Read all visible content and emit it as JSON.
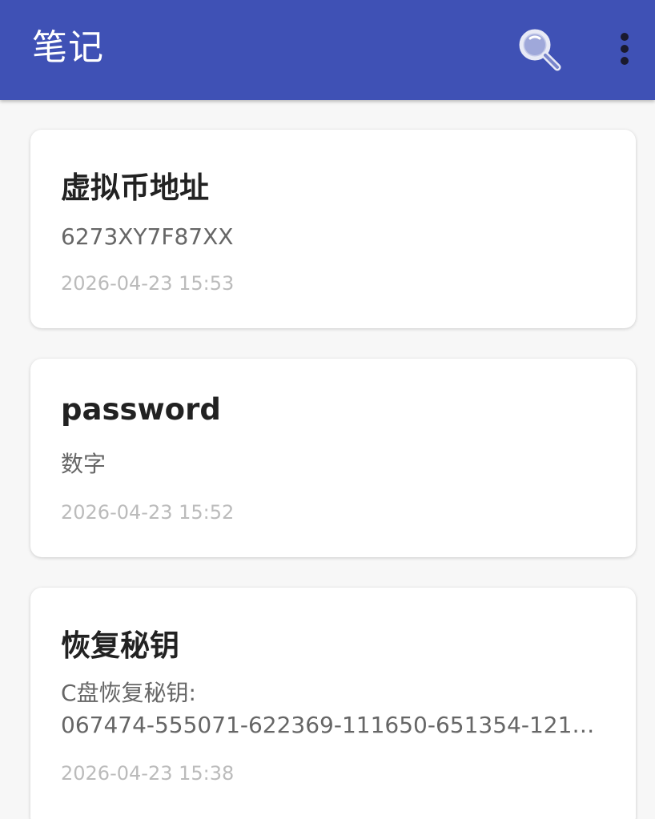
{
  "app_bar": {
    "title": "笔记",
    "search_icon": "search-icon",
    "more_icon": "more-vertical-icon",
    "bg_color": "#3f51b5"
  },
  "notes": [
    {
      "title": "虚拟币地址",
      "body": "6273XY7F87XX",
      "timestamp": "2026-04-23 15:53"
    },
    {
      "title": "password",
      "body": "数字",
      "timestamp": "2026-04-23 15:52"
    },
    {
      "title": "恢复秘钥",
      "body_line1": "C盘恢复秘钥:",
      "body_line2": "067474-555071-622369-111650-651354-121…",
      "timestamp": "2026-04-23 15:38"
    }
  ]
}
